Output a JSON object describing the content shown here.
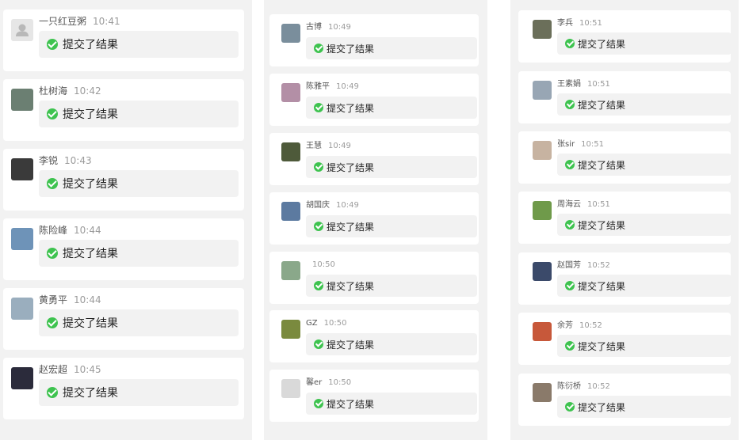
{
  "colors": {
    "accent": "#3ec34f",
    "page_bg": "#f2f2f2",
    "card_bg": "#ffffff",
    "bubble_bg": "#f2f2f2"
  },
  "status_text": "提交了结果",
  "columns": [
    {
      "messages": [
        {
          "name": "一只红豆粥",
          "time": "10:41",
          "avatar": "default-avatar"
        },
        {
          "name": "杜树海",
          "time": "10:42",
          "avatar": "person-photo"
        },
        {
          "name": "李锐",
          "time": "10:43",
          "avatar": "person-photo"
        },
        {
          "name": "陈险峰",
          "time": "10:44",
          "avatar": "lake-photo"
        },
        {
          "name": "黄勇平",
          "time": "10:44",
          "avatar": "tree-photo"
        },
        {
          "name": "赵宏超",
          "time": "10:45",
          "avatar": "night-photo"
        }
      ]
    },
    {
      "messages": [
        {
          "name": "古博",
          "time": "10:49",
          "avatar": "landscape-photo"
        },
        {
          "name": "陈雅平",
          "time": "10:49",
          "avatar": "flower-photo"
        },
        {
          "name": "王慧",
          "time": "10:49",
          "avatar": "person-photo"
        },
        {
          "name": "胡国庆",
          "time": "10:49",
          "avatar": "landscape-photo"
        },
        {
          "name": "",
          "time": "10:50",
          "avatar": "person-photo"
        },
        {
          "name": "GZ",
          "time": "10:50",
          "avatar": "field-photo"
        },
        {
          "name": "馨er",
          "time": "10:50",
          "avatar": "cartoon-avatar"
        }
      ]
    },
    {
      "messages": [
        {
          "name": "李兵",
          "time": "10:51",
          "avatar": "person-photo"
        },
        {
          "name": "王素娟",
          "time": "10:51",
          "avatar": "person-photo"
        },
        {
          "name": "张sir",
          "time": "10:51",
          "avatar": "group-photo"
        },
        {
          "name": "周海云",
          "time": "10:51",
          "avatar": "grass-photo"
        },
        {
          "name": "赵国芳",
          "time": "10:52",
          "avatar": "person-photo"
        },
        {
          "name": "余芳",
          "time": "10:52",
          "avatar": "flower-photo"
        },
        {
          "name": "陈衍桥",
          "time": "10:52",
          "avatar": "group-photo"
        }
      ]
    }
  ]
}
